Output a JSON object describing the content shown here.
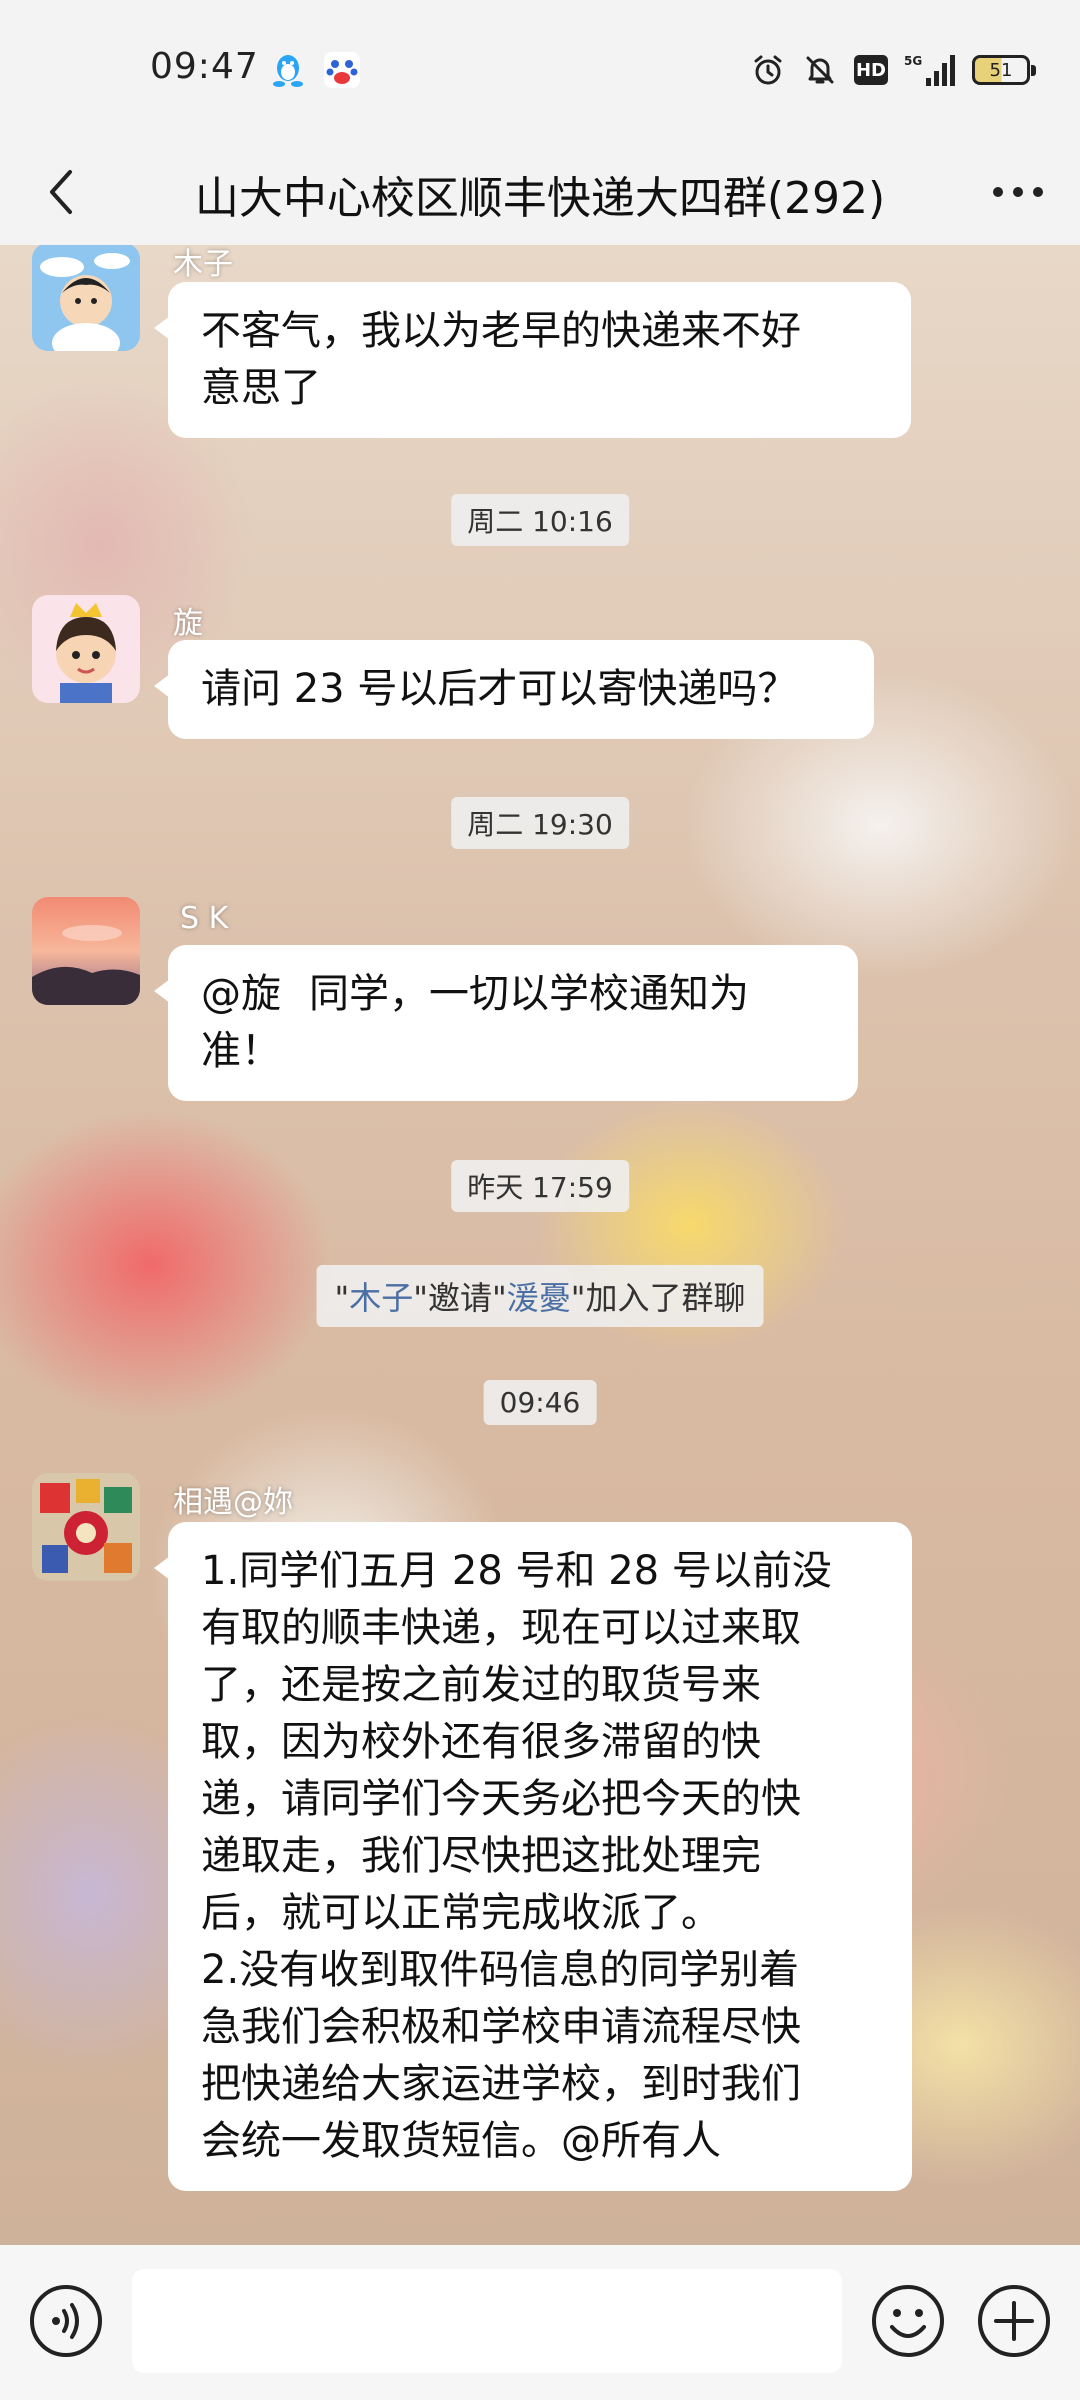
{
  "status_bar": {
    "time": "09:47",
    "battery": "51",
    "battery_level_pct": 51,
    "hd_label": "HD",
    "network": "5G"
  },
  "header": {
    "title": "山大中心校区顺丰快递大四群(292)"
  },
  "messages": [
    {
      "sender": "木子",
      "text": "不客气，我以为老早的快递来不好意思了"
    },
    {
      "timestamp": "周二 10:16"
    },
    {
      "sender": "旋",
      "text": "请问 23 号以后才可以寄快递吗？"
    },
    {
      "timestamp": "周二 19:30"
    },
    {
      "sender": "S K",
      "mention": "@旋",
      "text": "同学，一切以学校通知为准！"
    },
    {
      "timestamp": "昨天 17:59"
    },
    {
      "system": {
        "q1": "\"",
        "inviter": "木子",
        "q2": "\"邀请\"",
        "invitee": "湲憂",
        "q3": "\"加入了群聊"
      }
    },
    {
      "timestamp": "09:46"
    },
    {
      "sender": "相遇@妳",
      "text": "1.同学们五月 28 号和 28 号以前没有取的顺丰快递，现在可以过来取了，还是按之前发过的取货号来取，因为校外还有很多滞留的快递，请同学们今天务必把今天的快递取走，我们尽快把这批处理完后，就可以正常完成收派了。\n2.没有收到取件码信息的同学别着急我们会积极和学校申请流程尽快把快递给大家运进学校，到时我们会统一发取货短信。@所有人"
    }
  ],
  "bubble_lines": {
    "m1": [
      "不客气，我以为老早的快递来不好",
      "意思了"
    ],
    "m3": [
      "请问 23 号以后才可以寄快递吗？"
    ],
    "m5": [
      "同学，一切以学校通知为",
      "准！"
    ],
    "m9": [
      "1.同学们五月 28 号和 28 号以前没",
      "有取的顺丰快递，现在可以过来取",
      "了，还是按之前发过的取货号来",
      "取，因为校外还有很多滞留的快",
      "递，请同学们今天务必把今天的快",
      "递取走，我们尽快把这批处理完",
      "后，就可以正常完成收派了。",
      "2.没有收到取件码信息的同学别着",
      "急我们会积极和学校申请流程尽快",
      "把快递给大家运进学校，到时我们",
      "会统一发取货短信。@所有人"
    ]
  },
  "input": {
    "placeholder": ""
  },
  "icons": {
    "back": "chevron-left-icon",
    "more": "more-dots-icon",
    "voice": "voice-icon",
    "emoji": "emoji-icon",
    "plus": "plus-icon",
    "app1": "qq-penguin-icon",
    "app2": "baidu-paw-icon",
    "alarm": "alarm-icon",
    "mute": "bell-off-icon",
    "signal": "signal-icon"
  },
  "colors": {
    "bubble": "#ffffff",
    "mention_highlight": "#4a6fa5",
    "qq_blue": "#2aa4f4"
  }
}
